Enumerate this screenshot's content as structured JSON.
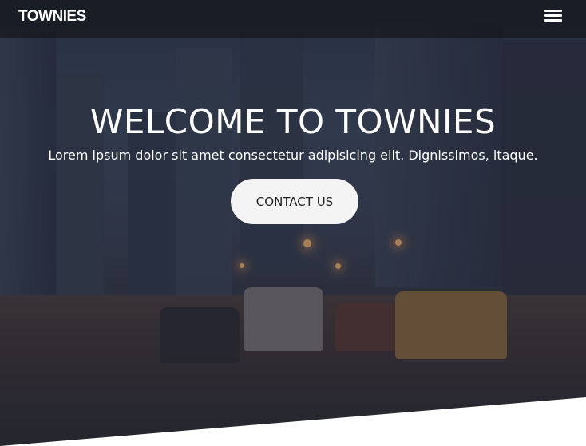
{
  "navbar": {
    "brand": "TOWNIES",
    "menu_icon": "hamburger-menu-icon"
  },
  "hero": {
    "title": "WELCOME TO TOWNIES",
    "subtitle": "Lorem ipsum dolor sit amet consectetur adipisicing elit. Dignissimos, itaque.",
    "cta_label": "CONTACT US"
  }
}
